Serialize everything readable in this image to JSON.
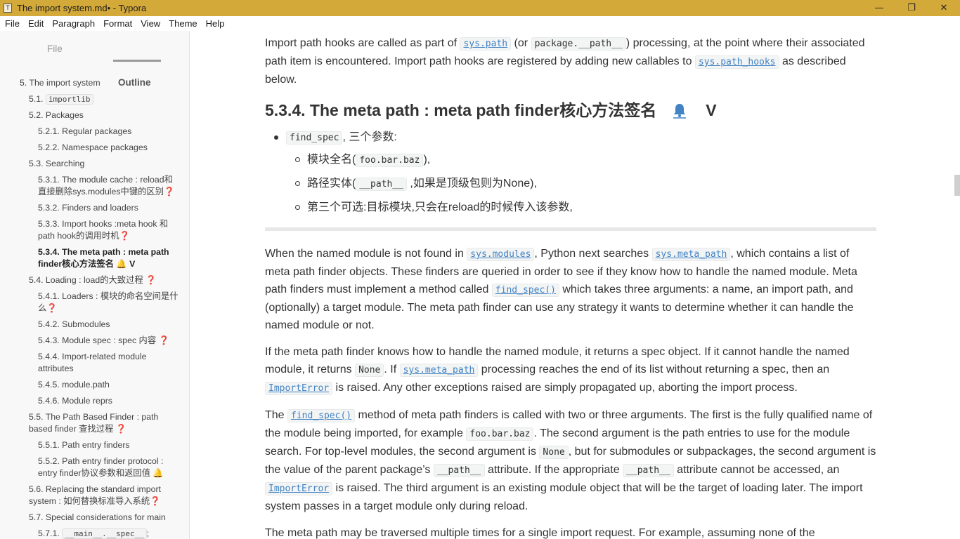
{
  "window": {
    "title": "The import system.md• - Typora",
    "app_icon": "T",
    "controls": {
      "minimize": "—",
      "maximize": "❐",
      "close": "✕"
    }
  },
  "menu": [
    "File",
    "Edit",
    "Paragraph",
    "Format",
    "View",
    "Theme",
    "Help"
  ],
  "sidebar": {
    "tabs": {
      "file": "File",
      "outline": "Outline"
    },
    "outline": [
      {
        "level": 1,
        "text": "5. The import system"
      },
      {
        "level": 2,
        "prefix": "5.1. ",
        "code": "importlib"
      },
      {
        "level": 2,
        "text": "5.2. Packages"
      },
      {
        "level": 3,
        "text": "5.2.1. Regular packages"
      },
      {
        "level": 3,
        "text": "5.2.2. Namespace packages"
      },
      {
        "level": 2,
        "text": "5.3. Searching"
      },
      {
        "level": 3,
        "text": "5.3.1. The module cache : reload和直接删除sys.modules中键的区别",
        "mark": "❓"
      },
      {
        "level": 3,
        "text": "5.3.2. Finders and loaders"
      },
      {
        "level": 3,
        "text": "5.3.3. Import hooks :meta hook 和 path hook的调用时机",
        "mark": "❓"
      },
      {
        "level": 3,
        "text": "5.3.4. The meta path : meta path finder核心方法签名 ",
        "bell": "🔔",
        "suffix": " V",
        "active": true
      },
      {
        "level": 2,
        "text": "5.4. Loading : load的大致过程 ",
        "mark": "❓"
      },
      {
        "level": 3,
        "text": "5.4.1. Loaders : 模块的命名空间是什么",
        "mark": "❓"
      },
      {
        "level": 3,
        "text": "5.4.2. Submodules"
      },
      {
        "level": 3,
        "text": "5.4.3. Module spec : spec 内容 ",
        "mark": "❓"
      },
      {
        "level": 3,
        "text": "5.4.4. Import-related module attributes"
      },
      {
        "level": 3,
        "text": "5.4.5. module.path"
      },
      {
        "level": 3,
        "text": "5.4.6. Module reprs"
      },
      {
        "level": 2,
        "text": "5.5. The Path Based Finder : path based finder 查找过程 ",
        "mark": "❓"
      },
      {
        "level": 3,
        "text": "5.5.1. Path entry finders"
      },
      {
        "level": 3,
        "text": "5.5.2. Path entry finder protocol : entry finder协议参数和返回值 ",
        "bell": "🔔"
      },
      {
        "level": 2,
        "text": "5.6. Replacing the standard import system : 如何替换标准导入系统",
        "mark": "❓"
      },
      {
        "level": 2,
        "text": "5.7. Special considerations for main"
      },
      {
        "level": 3,
        "prefix": "5.7.1. ",
        "code": "__main__.__spec__",
        "suffix": ";"
      }
    ]
  },
  "content": {
    "p_top": {
      "t1": "Import path hooks are called as part of ",
      "c1": "sys.path",
      "t2": " (or ",
      "c2": "package.__path__",
      "t3": ") processing, at the point where their associated path item is encountered. Import path hooks are registered by adding new callables to ",
      "c3": "sys.path_hooks",
      "t4": " as described below."
    },
    "heading": {
      "text": "5.3.4. The meta path : meta path finder核心方法签名",
      "bell": "🔔",
      "suffix": "V"
    },
    "bullets": {
      "main_code": "find_spec",
      "main_text": ", 三个参数:",
      "sub": [
        {
          "t1": "模块全名(",
          "code": "foo.bar.baz",
          "t2": "),"
        },
        {
          "t1": "路径实体(",
          "code": "__path__",
          "t2": " ,如果是顶级包则为None),"
        },
        {
          "t1": "第三个可选:目标模块,只会在reload的时候传入该参数,",
          "code": "",
          "t2": ""
        }
      ]
    },
    "p1": {
      "t1": "When the named module is not found in ",
      "c1": "sys.modules",
      "t2": ", Python next searches ",
      "c2": "sys.meta_path",
      "t3": ", which contains a list of meta path finder objects. These finders are queried in order to see if they know how to handle the named module. Meta path finders must implement a method called ",
      "c3": "find_spec()",
      "t4": " which takes three arguments: a name, an import path, and (optionally) a target module. The meta path finder can use any strategy it wants to determine whether it can handle the named module or not."
    },
    "p2": {
      "t1": "If the meta path finder knows how to handle the named module, it returns a spec object. If it cannot handle the named module, it returns ",
      "c1": "None",
      "t2": ". If ",
      "c2": "sys.meta_path",
      "t3": " processing reaches the end of its list without returning a spec, then an ",
      "c3": "ImportError",
      "t4": " is raised. Any other exceptions raised are simply propagated up, aborting the import process."
    },
    "p3": {
      "t1": "The ",
      "c1": "find_spec()",
      "t2": " method of meta path finders is called with two or three arguments. The first is the fully qualified name of the module being imported, for example ",
      "c2": "foo.bar.baz",
      "t3": ". The second argument is the path entries to use for the module search. For top-level modules, the second argument is ",
      "c3": "None",
      "t4": ", but for submodules or subpackages, the second argument is the value of the parent package’s ",
      "c4": "__path__",
      "t5": " attribute. If the appropriate ",
      "c5": "__path__",
      "t6": " attribute cannot be accessed, an ",
      "c6": "ImportError",
      "t7": " is raised. The third argument is an existing module object that will be the target of loading later. The import system passes in a target module only during reload."
    },
    "p4": "The meta path may be traversed multiple times for a single import request. For example, assuming none of the"
  }
}
